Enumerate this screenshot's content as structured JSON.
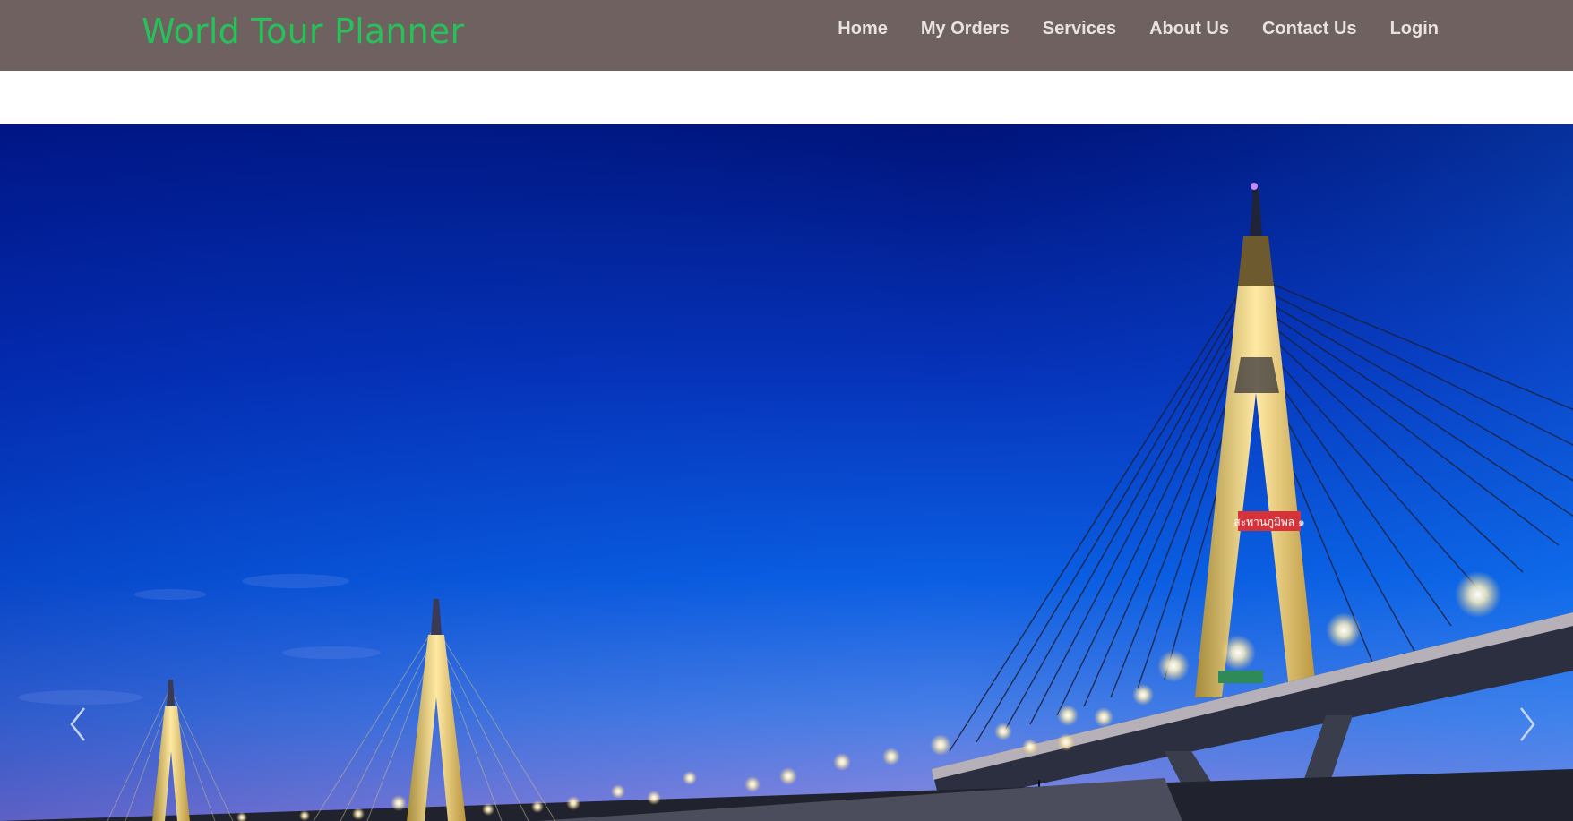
{
  "header": {
    "brand": "World Tour Planner",
    "nav": [
      {
        "label": "Home"
      },
      {
        "label": "My Orders"
      },
      {
        "label": "Services"
      },
      {
        "label": "About Us"
      },
      {
        "label": "Contact Us"
      },
      {
        "label": "Login"
      }
    ]
  },
  "hero": {
    "image": "bridge-at-night",
    "sign_text": "สะพานภูมิพล ๑",
    "prev_icon": "chevron-left-icon",
    "next_icon": "chevron-right-icon"
  },
  "colors": {
    "navbar_bg": "#6e615f",
    "brand": "#27c15a",
    "nav_text": "#e6e3e2",
    "sky_top": "#00137a",
    "sky_mid": "#0a49d6",
    "sky_bottom": "#7a84e0"
  }
}
